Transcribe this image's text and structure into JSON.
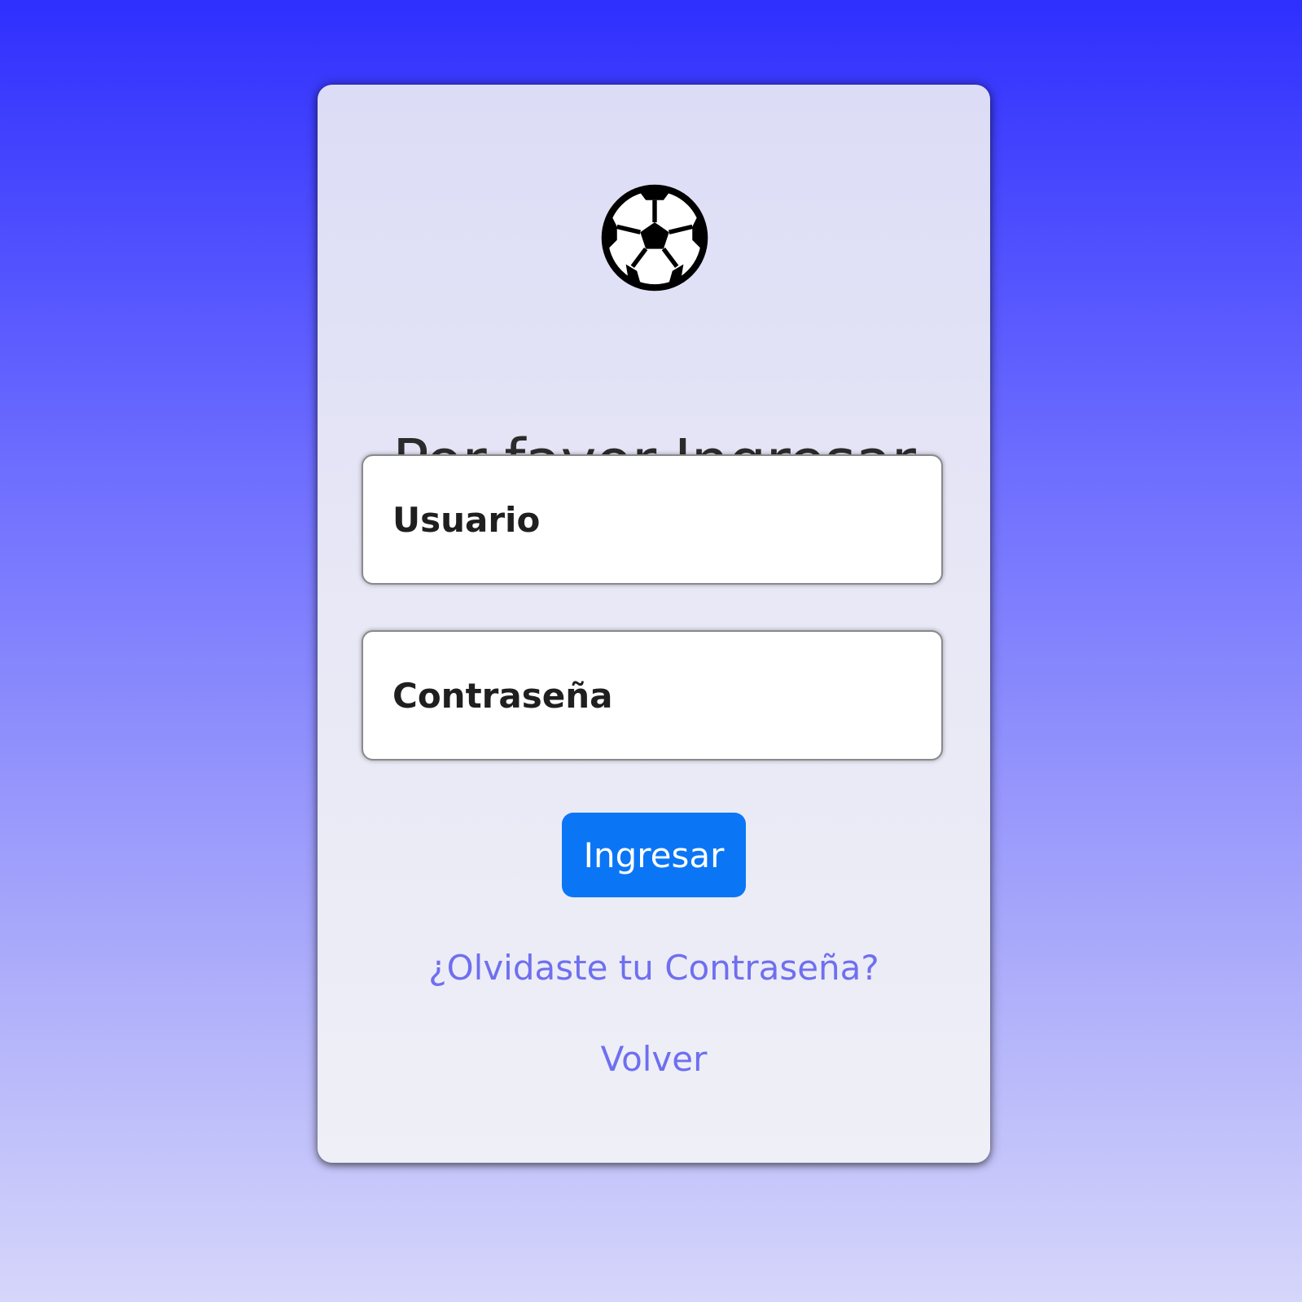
{
  "login": {
    "logo_icon": "soccer-ball-icon",
    "title": "Por favor Ingresar",
    "username_placeholder": "Usuario",
    "password_placeholder": "Contraseña",
    "submit_label": "Ingresar",
    "forgot_password_label": "¿Olvidaste tu Contraseña?",
    "back_label": "Volver"
  },
  "colors": {
    "button": "#0b76f5",
    "link": "#6f6ff0",
    "background_top": "#2f2ffe",
    "background_bottom": "#d6d6fb"
  }
}
